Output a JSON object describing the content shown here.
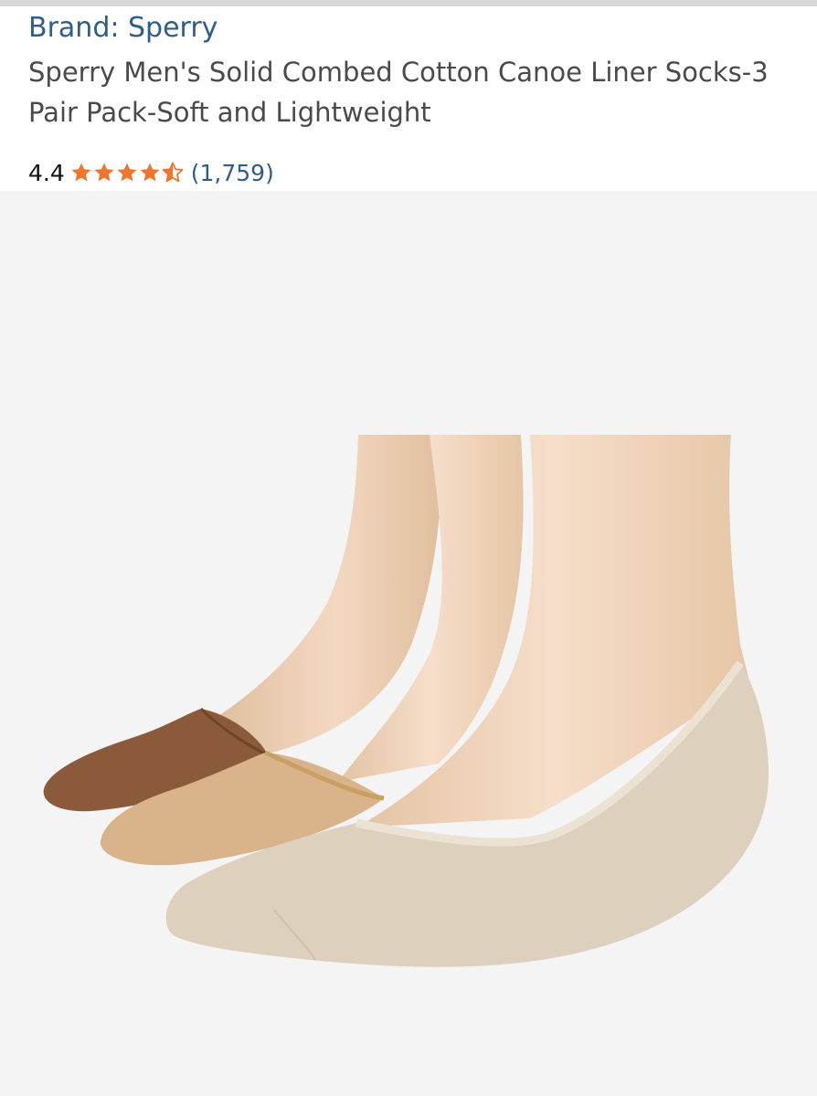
{
  "product": {
    "brand_label": "Brand: Sperry",
    "title": "Sperry Men's Solid Combed Cotton Canoe Liner Socks-3 Pair Pack-Soft and Lightweight",
    "rating": {
      "value_text": "4.4",
      "value": 4.4,
      "max": 5,
      "reviews_text": "(1,759)",
      "star_color": "#f0752d"
    },
    "image": {
      "alt": "Three feet wearing brown, tan and beige canoe liner socks",
      "sock_colors": [
        "#8a5a3b",
        "#d9b48a",
        "#ddd0bc"
      ]
    }
  }
}
